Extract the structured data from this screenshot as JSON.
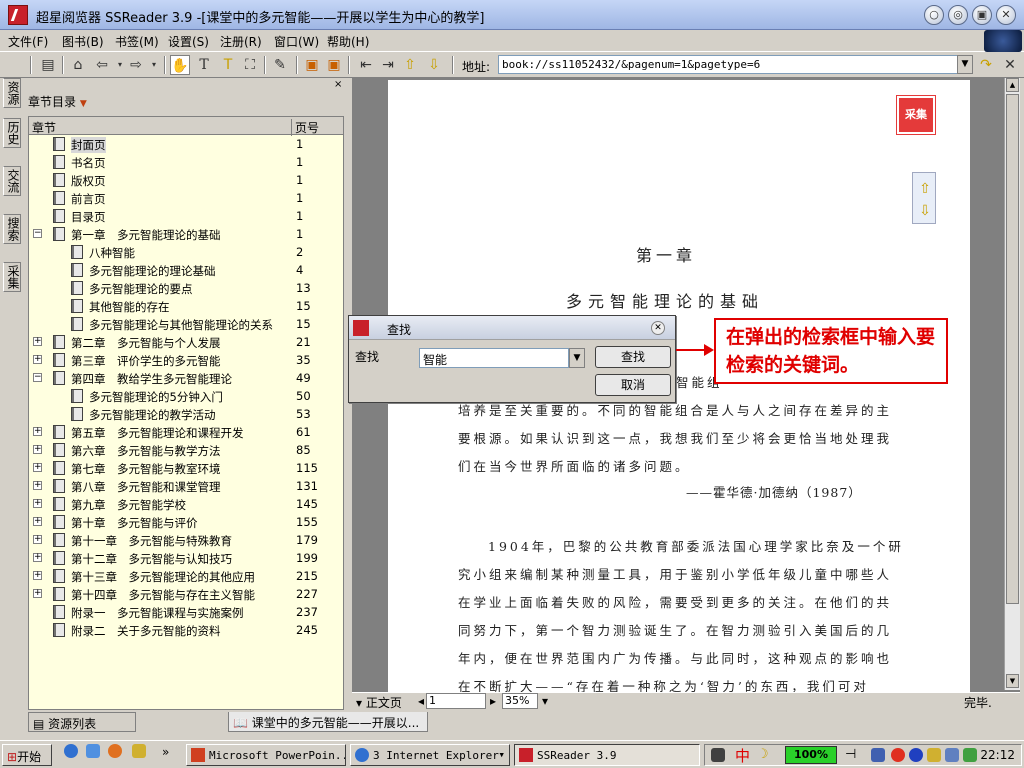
{
  "window": {
    "title": "超星阅览器 SSReader 3.9 -[课堂中的多元智能——开展以学生为中心的教学]",
    "minimize": "○",
    "restore": "◎",
    "maximize": "▣",
    "close": "✕"
  },
  "menu": [
    "文件(F)",
    "图书(B)",
    "书签(M)",
    "设置(S)",
    "注册(R)",
    "窗口(W)",
    "帮助(H)"
  ],
  "address": {
    "label": "地址:",
    "value": "book://ss11052432/&pagenum=1&pagetype=6"
  },
  "side_tabs": [
    "资源",
    "历史",
    "交流",
    "搜索",
    "采集"
  ],
  "panel": {
    "title": "章节目录",
    "col_chapter": "章节",
    "col_page": "页号",
    "close": "×"
  },
  "tree": [
    {
      "label": "封面页",
      "page": "1",
      "level": 0,
      "sel": true
    },
    {
      "label": "书名页",
      "page": "1",
      "level": 0
    },
    {
      "label": "版权页",
      "page": "1",
      "level": 0
    },
    {
      "label": "前言页",
      "page": "1",
      "level": 0
    },
    {
      "label": "目录页",
      "page": "1",
      "level": 0
    },
    {
      "label": "第一章　多元智能理论的基础",
      "page": "1",
      "level": 0,
      "exp": "−"
    },
    {
      "label": "八种智能",
      "page": "2",
      "level": 1
    },
    {
      "label": "多元智能理论的理论基础",
      "page": "4",
      "level": 1
    },
    {
      "label": "多元智能理论的要点",
      "page": "13",
      "level": 1
    },
    {
      "label": "其他智能的存在",
      "page": "15",
      "level": 1
    },
    {
      "label": "多元智能理论与其他智能理论的关系",
      "page": "15",
      "level": 1
    },
    {
      "label": "第二章　多元智能与个人发展",
      "page": "21",
      "level": 0,
      "exp": "+"
    },
    {
      "label": "第三章　评价学生的多元智能",
      "page": "35",
      "level": 0,
      "exp": "+"
    },
    {
      "label": "第四章　教给学生多元智能理论",
      "page": "49",
      "level": 0,
      "exp": "−"
    },
    {
      "label": "多元智能理论的5分钟入门",
      "page": "50",
      "level": 1
    },
    {
      "label": "多元智能理论的教学活动",
      "page": "53",
      "level": 1
    },
    {
      "label": "第五章　多元智能理论和课程开发",
      "page": "61",
      "level": 0,
      "exp": "+"
    },
    {
      "label": "第六章　多元智能与教学方法",
      "page": "85",
      "level": 0,
      "exp": "+"
    },
    {
      "label": "第七章　多元智能与教室环境",
      "page": "115",
      "level": 0,
      "exp": "+"
    },
    {
      "label": "第八章　多元智能和课堂管理",
      "page": "131",
      "level": 0,
      "exp": "+"
    },
    {
      "label": "第九章　多元智能学校",
      "page": "145",
      "level": 0,
      "exp": "+"
    },
    {
      "label": "第十章　多元智能与评价",
      "page": "155",
      "level": 0,
      "exp": "+"
    },
    {
      "label": "第十一章　多元智能与特殊教育",
      "page": "179",
      "level": 0,
      "exp": "+"
    },
    {
      "label": "第十二章　多元智能与认知技巧",
      "page": "199",
      "level": 0,
      "exp": "+"
    },
    {
      "label": "第十三章　多元智能理论的其他应用",
      "page": "215",
      "level": 0,
      "exp": "+"
    },
    {
      "label": "第十四章　多元智能与存在主义智能",
      "page": "227",
      "level": 0,
      "exp": "+"
    },
    {
      "label": "附录一　多元智能课程与实施案例",
      "page": "237",
      "level": 0
    },
    {
      "label": "附录二　关于多元智能的资料",
      "page": "245",
      "level": 0
    }
  ],
  "bottom_tabs": {
    "resources": "资源列表",
    "document": "课堂中的多元智能——开展以..."
  },
  "page_content": {
    "stamp": "采集",
    "chapter_number": "第一章",
    "chapter_title": "多元智能理论的基础",
    "quote_fragment_1": "智能组",
    "quote_line_2": "培养是至关重要的。不同的智能组合是人与人之间存在差异的主",
    "quote_line_3": "要根源。如果认识到这一点，我想我们至少将会更恰当地处理我",
    "quote_line_4": "们在当今世界所面临的诸多问题。",
    "attribution": "——霍华德·加德纳（1987）",
    "body_1": "1904年，巴黎的公共教育部委派法国心理学家比奈及一个研",
    "body_2": "究小组来编制某种测量工具，用于鉴别小学低年级儿童中哪些人",
    "body_3": "在学业上面临着失败的风险，需要受到更多的关注。在他们的共",
    "body_4": "同努力下，第一个智力测验诞生了。在智力测验引入美国后的几",
    "body_5": "年内，便在世界范围内广为传播。与此同时，这种观点的影响也",
    "body_6": "在不断扩大——“存在着一种称之为‘智力’的东西，我们可对"
  },
  "find_dialog": {
    "title": "查找",
    "label": "查找",
    "value": "智能",
    "search_button": "查找",
    "cancel_button": "取消"
  },
  "callout": "在弹出的检索框中输入要检索的关键词。",
  "reader_bar": {
    "mode": "▾ 正文页",
    "page": "1",
    "zoom": "35%",
    "status": "完毕."
  },
  "taskbar": {
    "start": "开始",
    "overflow": "»",
    "tasks": [
      "Microsoft PowerPoin...",
      "3 Internet Explorer",
      "SSReader 3.9"
    ],
    "battery": "100%",
    "ime": "中",
    "clock": "22:12"
  },
  "colors": {
    "tree_bg": "#ffffe0",
    "accent_red": "#e00000",
    "titlebar": "#c5d6f6"
  }
}
